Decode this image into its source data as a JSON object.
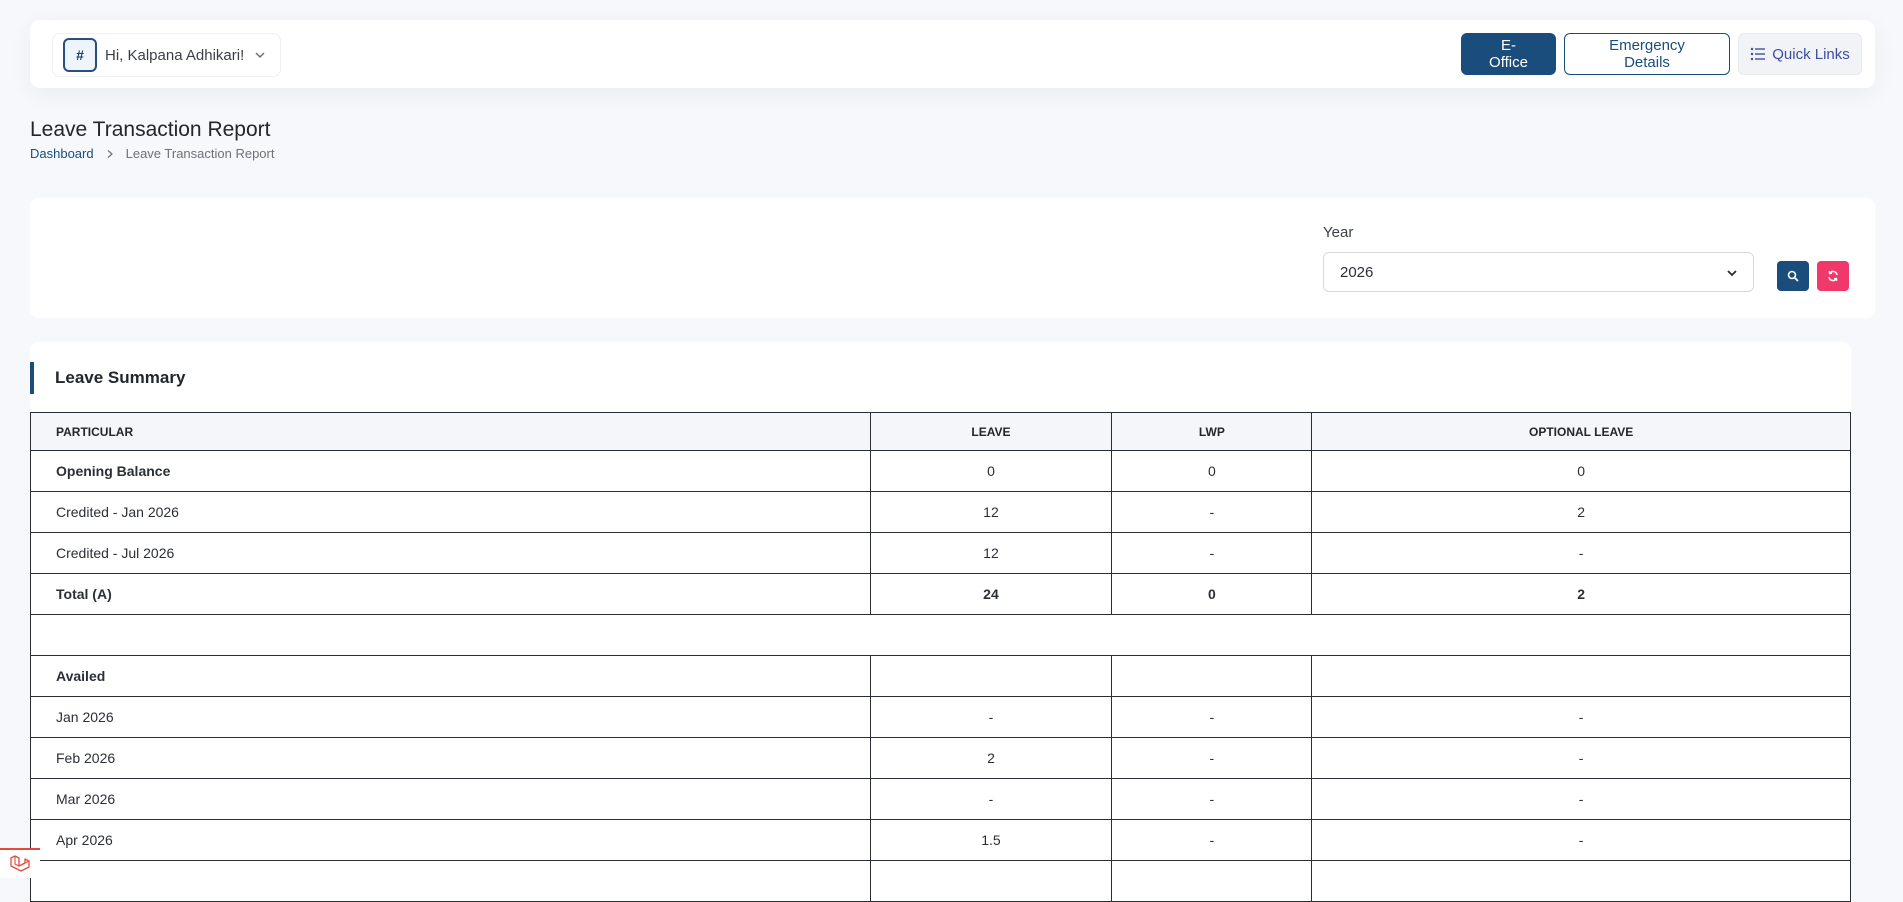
{
  "header": {
    "greeting": "Hi, Kalpana Adhikari!",
    "avatar_alt": "#",
    "eoffice_label": "E-Office",
    "emergency_label": "Emergency Details",
    "quick_links_label": "Quick Links"
  },
  "page": {
    "title": "Leave Transaction Report",
    "breadcrumb": {
      "home": "Dashboard",
      "current": "Leave Transaction Report"
    }
  },
  "filter": {
    "year_label": "Year",
    "year_value": "2026"
  },
  "summary": {
    "title": "Leave Summary",
    "columns": [
      "PARTICULAR",
      "LEAVE",
      "LWP",
      "OPTIONAL LEAVE"
    ],
    "rows": [
      {
        "particular": "Opening Balance",
        "leave": "0",
        "lwp": "0",
        "optional": "0"
      },
      {
        "particular": "Credited - Jan 2026",
        "leave": "12",
        "lwp": "-",
        "optional": "2"
      },
      {
        "particular": "Credited - Jul 2026",
        "leave": "12",
        "lwp": "-",
        "optional": "-"
      },
      {
        "particular": "Total (A)",
        "leave": "24",
        "lwp": "0",
        "optional": "2"
      },
      {
        "particular": "",
        "leave": "",
        "lwp": "",
        "optional": ""
      },
      {
        "particular": "Availed",
        "leave": "",
        "lwp": "",
        "optional": ""
      },
      {
        "particular": "Jan 2026",
        "leave": "-",
        "lwp": "-",
        "optional": "-"
      },
      {
        "particular": "Feb 2026",
        "leave": "2",
        "lwp": "-",
        "optional": "-"
      },
      {
        "particular": "Mar 2026",
        "leave": "-",
        "lwp": "-",
        "optional": "-"
      },
      {
        "particular": "Apr 2026",
        "leave": "1.5",
        "lwp": "-",
        "optional": "-"
      },
      {
        "particular": "",
        "leave": "",
        "lwp": "",
        "optional": ""
      }
    ]
  },
  "colors": {
    "primary": "#1a4c7c",
    "danger": "#f0386b",
    "accent": "#3b4ea3"
  }
}
